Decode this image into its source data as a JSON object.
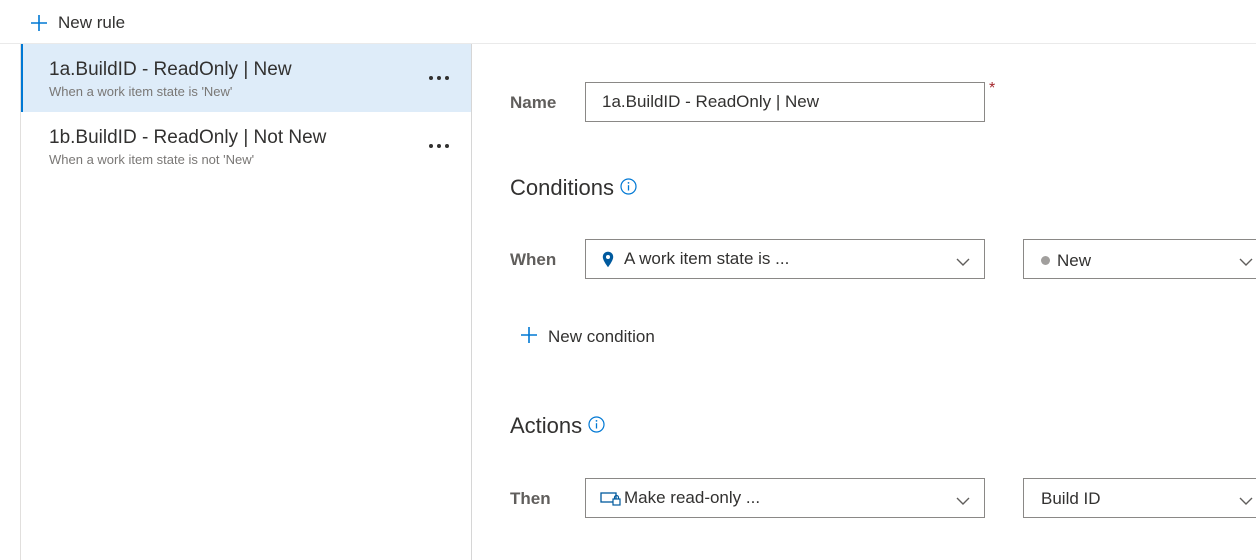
{
  "toolbar": {
    "new_rule_label": "New rule"
  },
  "rules": [
    {
      "title": "1a.BuildID - ReadOnly | New",
      "subtitle": "When a work item state is 'New'",
      "selected": true
    },
    {
      "title": "1b.BuildID - ReadOnly | Not New",
      "subtitle": "When a work item state is not 'New'",
      "selected": false
    }
  ],
  "form": {
    "name_label": "Name",
    "name_value": "1a.BuildID - ReadOnly | New",
    "required_marker": "*",
    "conditions_title": "Conditions",
    "when_label": "When",
    "condition_value": "A work item state is ...",
    "state_value": "New",
    "new_condition_label": "New condition",
    "actions_title": "Actions",
    "then_label": "Then",
    "action_value": "Make read-only ...",
    "field_value": "Build ID"
  },
  "colors": {
    "accent": "#0078d4",
    "selected_bg": "#deecf9",
    "required": "#a4262c"
  }
}
